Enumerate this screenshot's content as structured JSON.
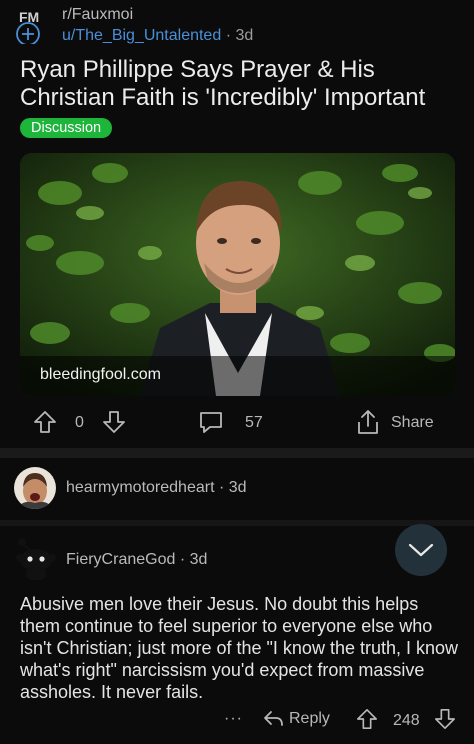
{
  "post": {
    "subreddit": "r/Fauxmoi",
    "author": "u/The_Big_Untalented",
    "time": "3d",
    "title": "Ryan Phillippe Says Prayer & His Christian Faith is 'Incredibly' Important",
    "flair": "Discussion",
    "flair_color": "#1db53a",
    "link_domain": "bleedingfool.com",
    "votes": "0",
    "comments": "57",
    "share_label": "Share"
  },
  "comments": [
    {
      "username": "hearmymotoredheart",
      "time": "3d"
    },
    {
      "username": "FieryCraneGod",
      "time": "3d",
      "body": "Abusive men love their Jesus. No doubt this helps them continue to feel superior to everyone else who isn't Christian; just more of the \"I know the truth, I know what's right\" narcissism you'd expect from massive assholes. It never fails.",
      "more": "···",
      "reply_label": "Reply",
      "votes": "248"
    }
  ],
  "accent_color": "#4a8fd8"
}
